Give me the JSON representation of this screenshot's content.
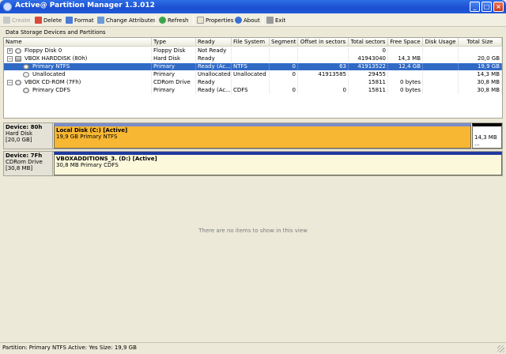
{
  "window": {
    "title": "Active@ Partition Manager 1.3.012"
  },
  "toolbar": {
    "create": "Create",
    "delete": "Delete",
    "format": "Format",
    "change_attributes": "Change Attributes",
    "refresh": "Refresh",
    "properties": "Properties",
    "about": "About",
    "exit": "Exit"
  },
  "section": {
    "label": "Data Storage Devices and Partitions"
  },
  "columns": [
    "Name",
    "Type",
    "Ready",
    "File System",
    "Segment",
    "Offset in sectors",
    "Total sectors",
    "Free Space",
    "Disk Usage",
    "Total Size"
  ],
  "rows": [
    {
      "name": "Floppy Disk 0",
      "type": "Floppy Disk",
      "ready": "Not Ready",
      "fs": "",
      "segment": "",
      "offset": "",
      "total_sectors": "0",
      "free": "",
      "usage": "",
      "size": ""
    },
    {
      "name": "VBOX HARDDISK (80h)",
      "type": "Hard Disk",
      "ready": "Ready",
      "fs": "",
      "segment": "",
      "offset": "",
      "total_sectors": "41943040",
      "free": "14,3 MB",
      "usage": "",
      "size": "20,0 GB"
    },
    {
      "name": "Primary NTFS",
      "type": "Primary",
      "ready": "Ready (Ac...",
      "fs": "NTFS",
      "segment": "0",
      "offset": "63",
      "total_sectors": "41913522",
      "free": "12,4 GB",
      "usage": "",
      "size": "19,9 GB"
    },
    {
      "name": "Unallocated",
      "type": "Primary",
      "ready": "Unallocated",
      "fs": "Unallocated",
      "segment": "0",
      "offset": "41913585",
      "total_sectors": "29455",
      "free": "",
      "usage": "",
      "size": "14,3 MB"
    },
    {
      "name": "VBOX CD-ROM (7Fh)",
      "type": "CDRom Drive",
      "ready": "Ready",
      "fs": "",
      "segment": "",
      "offset": "",
      "total_sectors": "15811",
      "free": "0 bytes",
      "usage": "",
      "size": "30,8 MB"
    },
    {
      "name": "Primary CDFS",
      "type": "Primary",
      "ready": "Ready (Ac...",
      "fs": "CDFS",
      "segment": "0",
      "offset": "0",
      "total_sectors": "15811",
      "free": "0 bytes",
      "usage": "",
      "size": "30,8 MB"
    }
  ],
  "diskmap": {
    "hd": {
      "device": "Device: 80h",
      "kind": "Hard Disk",
      "size": "[20,0 GB]",
      "part_title": "Local Disk (C:) [Active]",
      "part_detail": "19,9 GB Primary NTFS",
      "unalloc": "14,3 MB ...",
      "part_color": "#f7b733",
      "used_color": "#7a8cc9"
    },
    "cd": {
      "device": "Device: 7Fh",
      "kind": "CDRom Drive",
      "size": "[30,8 MB]",
      "part_title": "VBOXADDITIONS_3. (D:) [Active]",
      "part_detail": "30,8 MB Primary CDFS",
      "part_color": "#fbf8dc",
      "used_color": "#203a9c"
    }
  },
  "empty_message": "There are no items to show in this view",
  "status": {
    "text": "Partition: Primary NTFS  Active: Yes  Size: 19,9 GB"
  },
  "icons": {
    "app": "app-icon",
    "create": "create-icon",
    "delete": "delete-icon",
    "format": "format-icon",
    "change": "change-attributes-icon",
    "refresh": "refresh-icon",
    "properties": "properties-icon",
    "about": "about-icon",
    "exit": "exit-icon"
  }
}
